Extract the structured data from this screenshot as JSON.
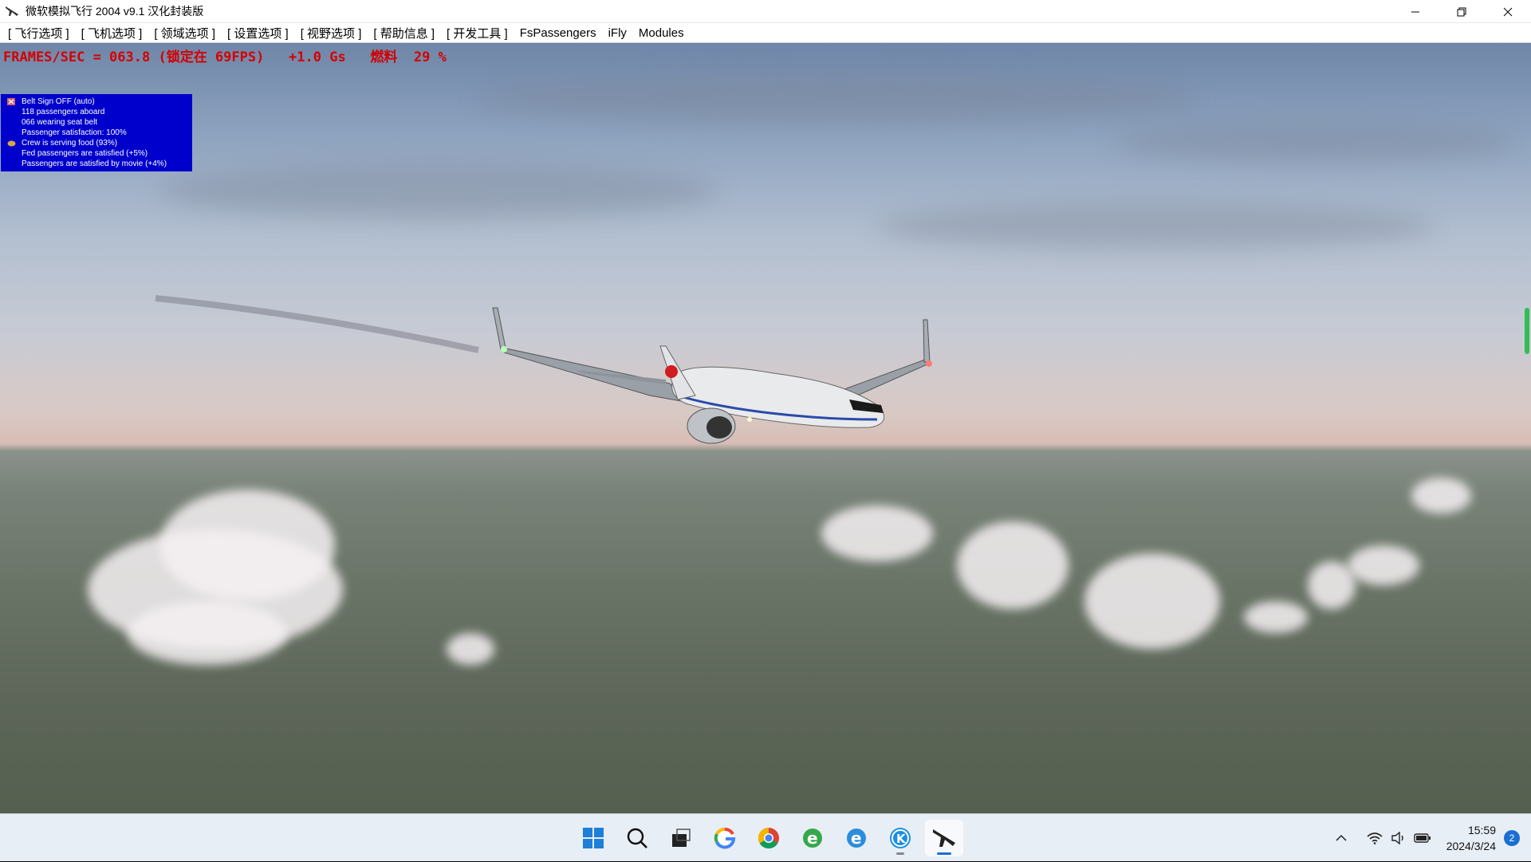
{
  "window": {
    "title": "微软模拟飞行 2004 v9.1 汉化封装版"
  },
  "menu": [
    "[ 飞行选项 ]",
    "[ 飞机选项 ]",
    "[ 领域选项 ]",
    "[ 设置选项 ]",
    "[ 视野选项 ]",
    "[ 帮助信息 ]",
    "[ 开发工具 ]",
    "FsPassengers",
    "iFly",
    "Modules"
  ],
  "hud": {
    "text": "FRAMES/SEC = 063.8 (锁定在 69FPS)   +1.0 Gs   燃料  29 %"
  },
  "passenger_info": [
    {
      "icon": "x-status-icon",
      "text": "Belt Sign OFF (auto)"
    },
    {
      "icon": "",
      "text": "118 passengers aboard"
    },
    {
      "icon": "",
      "text": "066 wearing seat belt"
    },
    {
      "icon": "",
      "text": "Passenger satisfaction: 100%"
    },
    {
      "icon": "food-icon",
      "text": "Crew is serving food (93%)"
    },
    {
      "icon": "",
      "text": "Fed passengers are satisfied (+5%)"
    },
    {
      "icon": "",
      "text": "Passengers are satisfied by movie (+4%)"
    }
  ],
  "taskbar": {
    "apps": [
      "start-icon",
      "search-icon",
      "task-view-icon",
      "google-icon",
      "chrome-icon",
      "ie-green-icon",
      "ie-icon",
      "k-app-icon",
      "flight-sim-icon"
    ],
    "time": "15:59",
    "date": "2024/3/24",
    "notifications": "2"
  },
  "colors": {
    "hud_text": "#d40000",
    "info_bg": "#0000cc",
    "accent": "#1a6fd1"
  }
}
